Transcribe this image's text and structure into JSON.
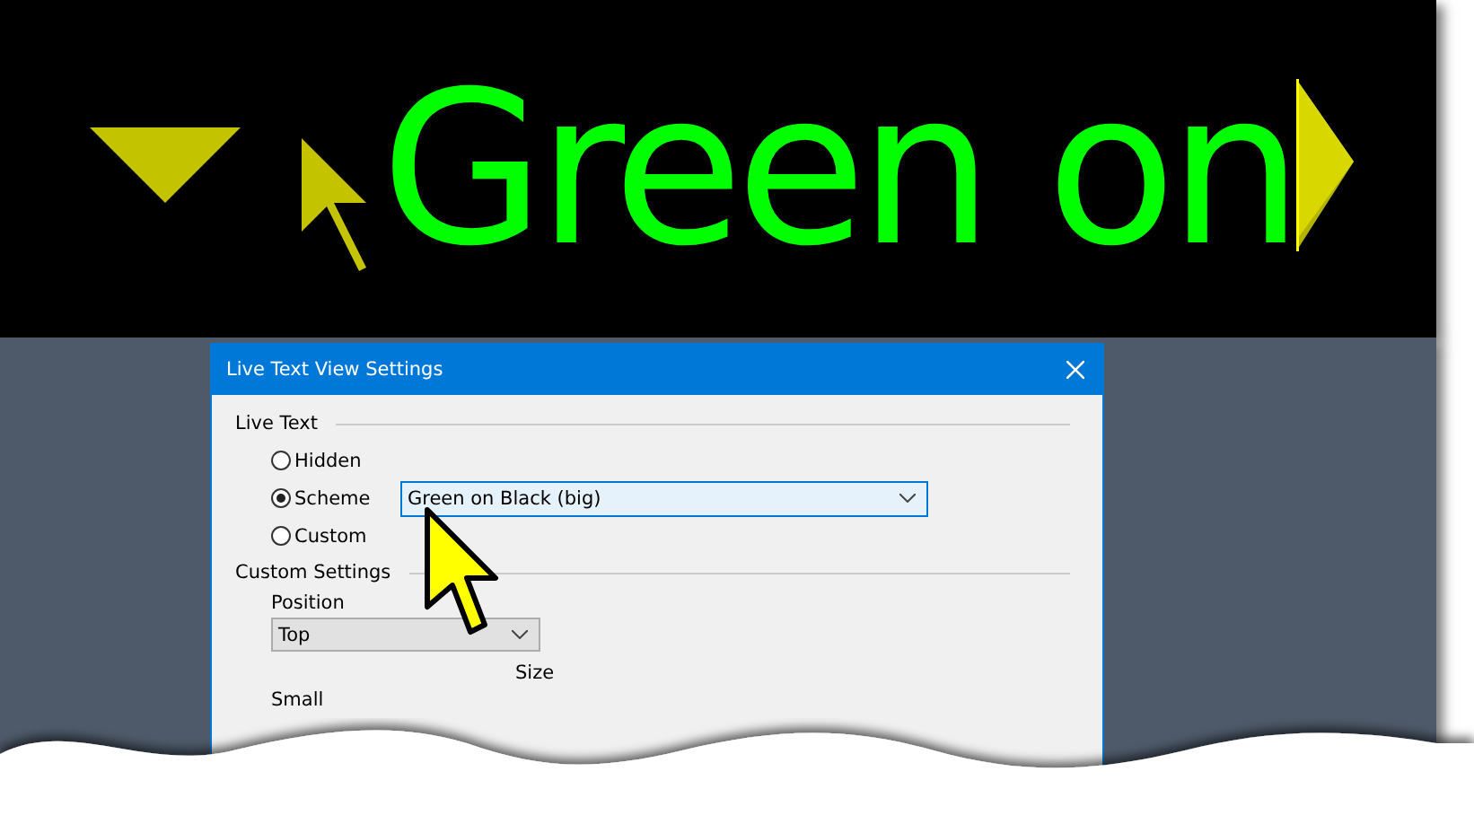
{
  "preview": {
    "text": "Green on"
  },
  "dialog": {
    "title": "Live Text View Settings",
    "live_text": {
      "heading": "Live Text",
      "options": [
        {
          "label": "Hidden",
          "selected": false
        },
        {
          "label": "Scheme",
          "selected": true
        },
        {
          "label": "Custom",
          "selected": false
        }
      ],
      "scheme_select": {
        "value": "Green on Black (big)"
      }
    },
    "custom_settings": {
      "heading": "Custom Settings",
      "position_label": "Position",
      "position_select": {
        "value": "Top"
      },
      "size_label": "Size",
      "size_min_label": "Small"
    }
  }
}
